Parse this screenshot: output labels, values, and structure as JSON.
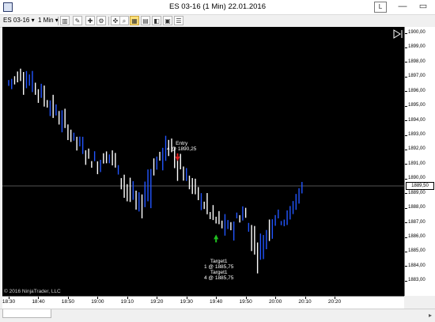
{
  "window": {
    "title": "ES 03-16 (1 Min)  22.01.2016",
    "layout_button": "L",
    "minimize": "—",
    "restore": "▭",
    "close": "✕"
  },
  "toolbar": {
    "instrument": "ES 03-16",
    "interval": "1 Min"
  },
  "chart": {
    "price_marker": "1889,50",
    "copyright": "© 2016 NinjaTrader, LLC",
    "entry": {
      "label": "Entry",
      "detail": "4 @ 1890,25"
    },
    "target1": {
      "label": "Target1",
      "detail": "1 @ 1885,75"
    },
    "target2": {
      "label": "Target1",
      "detail": "4 @ 1885,75"
    },
    "colors": {
      "up": "#2255ff",
      "down": "#ffffff",
      "background": "#000000",
      "line": "#6e6e6e",
      "entry_arrow": "#e02020",
      "exit_arrow": "#20c020"
    }
  },
  "chart_data": {
    "type": "bar",
    "y_ticks": [
      "1900,00",
      "1899,00",
      "1898,00",
      "1897,00",
      "1896,00",
      "1895,00",
      "1894,00",
      "1893,00",
      "1892,00",
      "1891,00",
      "1890,00",
      "1889,00",
      "1888,00",
      "1887,00",
      "1886,00",
      "1885,00",
      "1884,00",
      "1883,00"
    ],
    "x_ticks": [
      "18:30",
      "18:40",
      "18:50",
      "19:00",
      "19:10",
      "19:20",
      "19:30",
      "19:40",
      "19:50",
      "20:00",
      "20:10",
      "20:20"
    ],
    "ylim": [
      1882.5,
      1900.3
    ],
    "xlim": [
      "18:30",
      "20:22"
    ],
    "price_line": 1889.5,
    "series": [
      {
        "time": "18:30",
        "open": 1896.5,
        "high": 1898.0,
        "low": 1895.5,
        "close": 1897.25
      },
      {
        "time": "18:35",
        "open": 1897.0,
        "high": 1899.5,
        "low": 1895.75,
        "close": 1896.25
      },
      {
        "time": "18:40",
        "open": 1896.25,
        "high": 1897.25,
        "low": 1894.0,
        "close": 1895.0
      },
      {
        "time": "18:45",
        "open": 1895.0,
        "high": 1895.75,
        "low": 1892.5,
        "close": 1893.5
      },
      {
        "time": "18:50",
        "open": 1893.5,
        "high": 1894.0,
        "low": 1891.5,
        "close": 1892.25
      },
      {
        "time": "18:55",
        "open": 1892.25,
        "high": 1893.0,
        "low": 1890.0,
        "close": 1891.0
      },
      {
        "time": "19:00",
        "open": 1891.0,
        "high": 1892.75,
        "low": 1889.5,
        "close": 1891.75
      },
      {
        "time": "19:05",
        "open": 1891.75,
        "high": 1892.0,
        "low": 1888.5,
        "close": 1889.5
      },
      {
        "time": "19:10",
        "open": 1889.5,
        "high": 1890.5,
        "low": 1887.0,
        "close": 1888.0
      },
      {
        "time": "19:15",
        "open": 1888.0,
        "high": 1891.5,
        "low": 1886.5,
        "close": 1891.0
      },
      {
        "time": "19:20",
        "open": 1891.0,
        "high": 1893.0,
        "low": 1889.5,
        "close": 1892.25
      },
      {
        "time": "19:25",
        "open": 1892.25,
        "high": 1892.75,
        "low": 1889.0,
        "close": 1890.25
      },
      {
        "time": "19:30",
        "open": 1890.25,
        "high": 1891.0,
        "low": 1888.0,
        "close": 1888.75
      },
      {
        "time": "19:35",
        "open": 1888.75,
        "high": 1889.25,
        "low": 1886.5,
        "close": 1887.25
      },
      {
        "time": "19:40",
        "open": 1887.25,
        "high": 1888.5,
        "low": 1885.5,
        "close": 1886.5
      },
      {
        "time": "19:45",
        "open": 1886.5,
        "high": 1888.5,
        "low": 1885.75,
        "close": 1887.75
      },
      {
        "time": "19:50",
        "open": 1887.75,
        "high": 1888.0,
        "low": 1883.5,
        "close": 1884.75
      },
      {
        "time": "19:55",
        "open": 1884.75,
        "high": 1888.5,
        "low": 1884.0,
        "close": 1887.5
      },
      {
        "time": "20:00",
        "open": 1887.5,
        "high": 1888.75,
        "low": 1886.0,
        "close": 1887.25
      },
      {
        "time": "20:05",
        "open": 1887.25,
        "high": 1889.25,
        "low": 1886.5,
        "close": 1888.75
      },
      {
        "time": "20:08",
        "open": 1888.75,
        "high": 1890.0,
        "low": 1887.5,
        "close": 1889.5
      }
    ]
  }
}
